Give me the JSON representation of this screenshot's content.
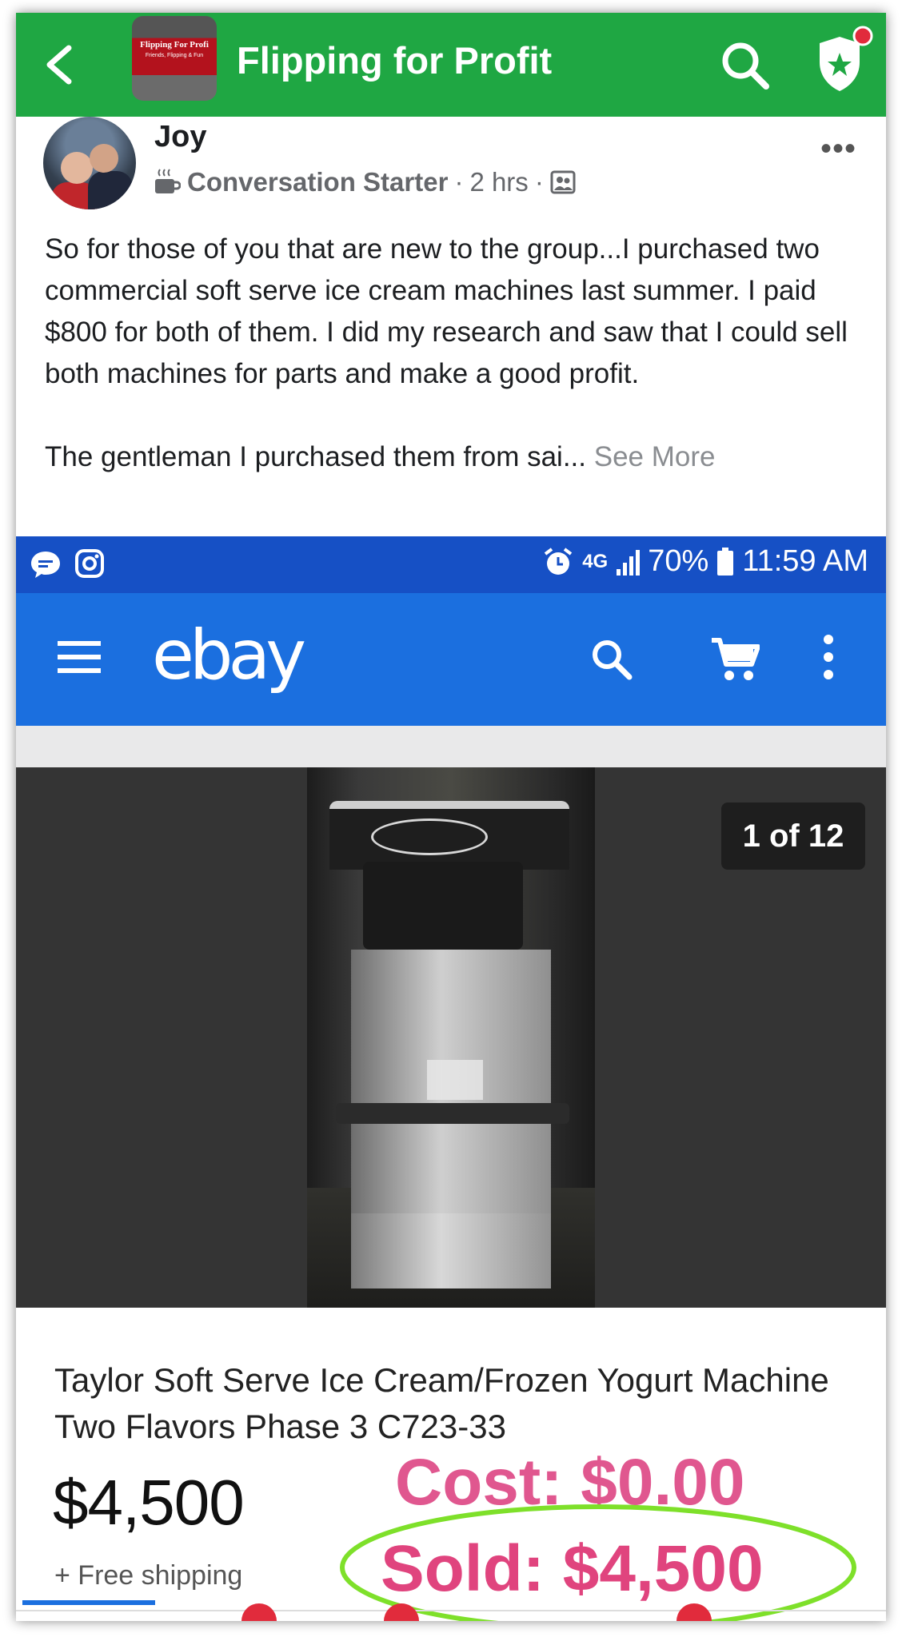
{
  "facebook": {
    "group_title": "Flipping for Profit",
    "group_thumb": {
      "title": "Flipping For Profi",
      "subtitle": "Friends, Flipping & Fun"
    },
    "colors": {
      "header": "#1fa743",
      "notification": "#e12b3c"
    },
    "icons": [
      "back-arrow-icon",
      "search-icon",
      "admin-shield-star-icon"
    ]
  },
  "post": {
    "author": "Joy",
    "badge": "Conversation Starter",
    "separator": "·",
    "time": "2 hrs",
    "paragraph_1": "So for those of you that are new to the group...I purchased two commercial soft serve ice cream machines last summer. I paid $800 for both of them. I did my research and saw that I could sell both machines for parts and make a good profit.",
    "paragraph_2": "The gentleman I purchased them from sai...",
    "see_more": "See More"
  },
  "ebay_screenshot": {
    "status_bar": {
      "network": "4G",
      "battery": "70%",
      "time": "11:59 AM"
    },
    "logo": "ebay",
    "colors": {
      "status_bar": "#1650c5",
      "app_bar": "#1b6fdf"
    },
    "photo_counter": "1 of 12",
    "listing": {
      "title": "Taylor Soft Serve Ice Cream/Frozen Yogurt Machine Two Flavors Phase 3 C723-33",
      "price": "$4,500",
      "shipping": "+ Free shipping"
    },
    "annotation": {
      "cost": "Cost: $0.00",
      "sold": "Sold: $4,500",
      "colors": {
        "text": "#e0447e",
        "circle": "#7ee02a"
      }
    }
  }
}
